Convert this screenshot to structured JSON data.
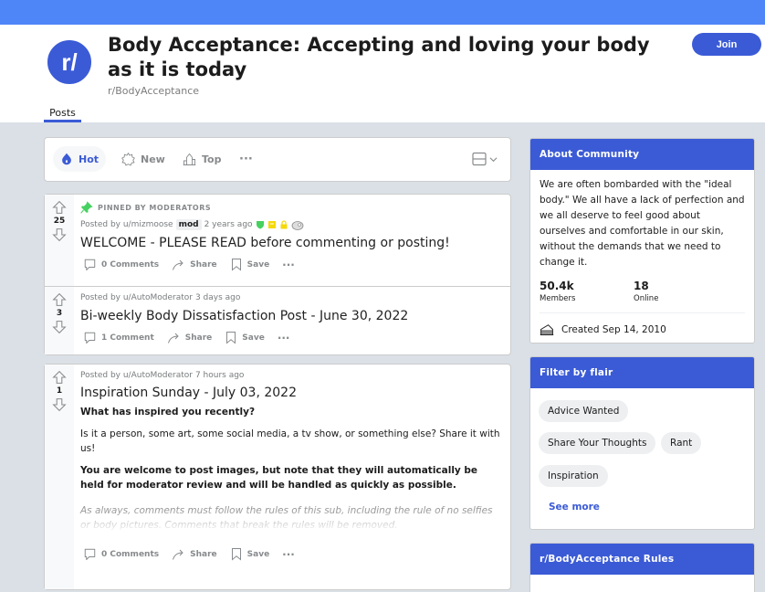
{
  "header": {
    "avatar_text": "r/",
    "title": "Body Acceptance: Accepting and loving your body as it is today",
    "subreddit": "r/BodyAcceptance",
    "join_label": "Join",
    "tab_posts": "Posts"
  },
  "sort": {
    "hot": "Hot",
    "new": "New",
    "top": "Top",
    "more": "···",
    "active": "Hot"
  },
  "posts": [
    {
      "pinned_label": "PINNED BY MODERATORS",
      "score": "25",
      "posted_by": "Posted by u/mizmoose",
      "badge": "mod",
      "time": "2 years ago",
      "title": "WELCOME - PLEASE READ before commenting or posting!",
      "comments": "0 Comments",
      "share": "Share",
      "save": "Save",
      "more": "···"
    },
    {
      "score": "3",
      "posted_by": "Posted by u/AutoModerator",
      "time": "3 days ago",
      "title": "Bi-weekly Body Dissatisfaction Post - June 30, 2022",
      "comments": "1 Comment",
      "share": "Share",
      "save": "Save",
      "more": "···"
    },
    {
      "score": "1",
      "posted_by": "Posted by u/AutoModerator",
      "time": "7 hours ago",
      "title": "Inspiration Sunday - July 03, 2022",
      "body": [
        "What has inspired you recently?",
        "Is it a person, some art, some social media, a tv show, or something else? Share it with us!",
        "You are welcome to post images, but note that they will automatically be held for moderator review and will be handled as quickly as possible.",
        "As always, comments must follow the rules of this sub, including the rule of no selfies or body pictures. Comments that break the rules will be removed."
      ],
      "comments": "0 Comments",
      "share": "Share",
      "save": "Save",
      "more": "···"
    }
  ],
  "about": {
    "heading": "About Community",
    "description": "We are often bombarded with the \"ideal body.\" We all have a lack of perfection and we all deserve to feel good about ourselves and comfortable in our skin, without the demands that we need to change it.",
    "members_count": "50.4k",
    "members_label": "Members",
    "online_count": "18",
    "online_label": "Online",
    "created": "Created Sep 14, 2010"
  },
  "flair": {
    "heading": "Filter by flair",
    "items": [
      "Advice Wanted",
      "Share Your Thoughts",
      "Rant",
      "Inspiration"
    ],
    "see_more": "See more"
  },
  "rules": {
    "heading": "r/BodyAcceptance Rules"
  },
  "colors": {
    "banner": "#4f86f7",
    "accent": "#3b5bd6",
    "pin": "#46d160"
  }
}
